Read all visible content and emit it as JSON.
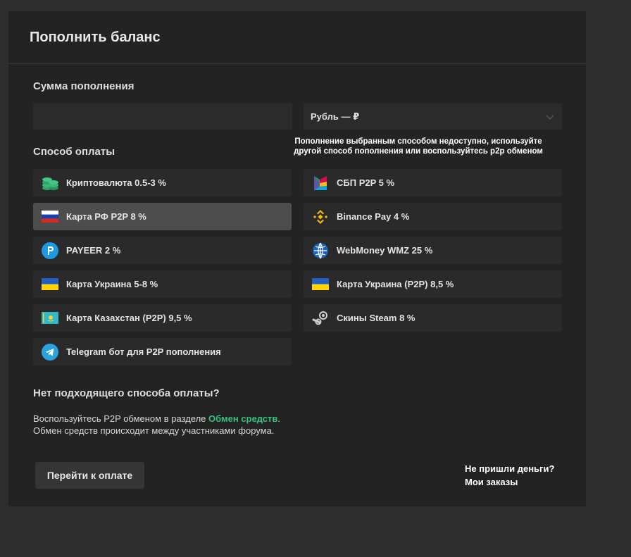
{
  "title": "Пополнить баланс",
  "amount": {
    "label": "Сумма пополнения",
    "value": "",
    "placeholder": ""
  },
  "currency": {
    "selected": "Рубль — ₽"
  },
  "payment": {
    "label": "Способ оплаты",
    "warning_line1": "Пополнение выбранным способом недоступно, используйте",
    "warning_line2": "другой способ пополнения  или воспользуйтесь p2p обменом",
    "left": [
      {
        "label": "Криптовалюта 0.5-3 %",
        "icon": "crypto-coins-icon"
      },
      {
        "label": "Карта РФ P2P 8 %",
        "icon": "russia-flag-icon",
        "selected": true
      },
      {
        "label": "PAYEER 2 %",
        "icon": "payeer-icon"
      },
      {
        "label": "Карта Украина 5-8 %",
        "icon": "ukraine-flag-icon"
      },
      {
        "label": "Карта Казахстан (P2P) 9,5 %",
        "icon": "kazakhstan-flag-icon"
      },
      {
        "label": "Telegram бот для P2P пополнения",
        "icon": "telegram-icon"
      }
    ],
    "right": [
      {
        "label": "СБП P2P 5 %",
        "icon": "sbp-icon"
      },
      {
        "label": "Binance Pay 4 %",
        "icon": "binance-icon"
      },
      {
        "label": "WebMoney WMZ 25 %",
        "icon": "webmoney-icon"
      },
      {
        "label": "Карта Украина (P2P) 8,5 %",
        "icon": "ukraine-flag-icon"
      },
      {
        "label": "Скины Steam 8 %",
        "icon": "steam-icon"
      }
    ]
  },
  "no_method": {
    "title": "Нет подходящего способа оплаты?",
    "line1_prefix": "Воспользуйтесь P2P обменом в разделе ",
    "link": "Обмен средств",
    "line1_suffix": ".",
    "line2": "Обмен средств происходит между участниками форума."
  },
  "actions": {
    "pay_button": "Перейти к оплате",
    "no_money": "Не пришли деньги?",
    "my_orders": "Мои заказы"
  },
  "colors": {
    "accent_link": "#35c27a",
    "selected_item": "#4d4d4d"
  }
}
